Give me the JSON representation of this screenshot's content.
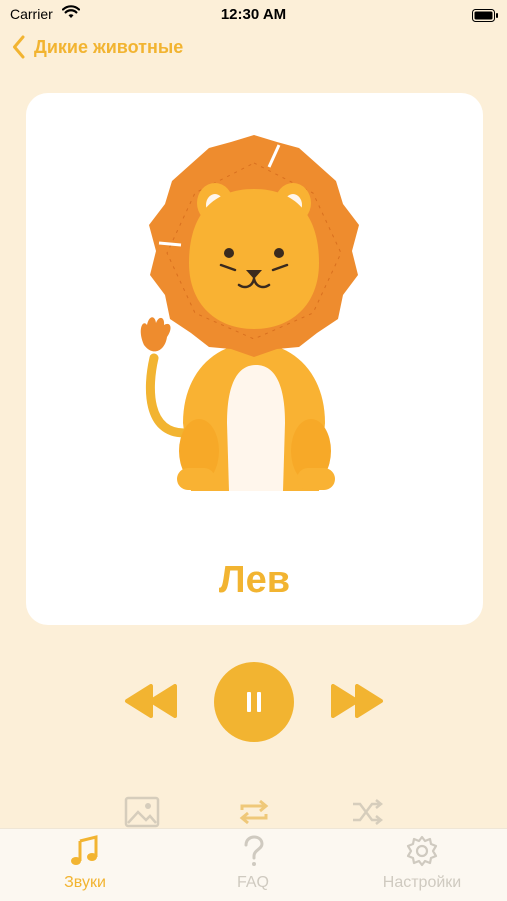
{
  "status_bar": {
    "carrier": "Carrier",
    "time": "12:30 AM"
  },
  "nav": {
    "back_label": "Дикие животные"
  },
  "card": {
    "animal_name": "Лев"
  },
  "player": {
    "state": "playing"
  },
  "tabs": [
    {
      "label": "Звуки",
      "icon": "music-note-icon",
      "active": true
    },
    {
      "label": "FAQ",
      "icon": "question-icon",
      "active": false
    },
    {
      "label": "Настройки",
      "icon": "gear-icon",
      "active": false
    }
  ],
  "colors": {
    "accent": "#F2B431",
    "background": "#FCEFD8",
    "inactive": "#CFCAC0"
  }
}
